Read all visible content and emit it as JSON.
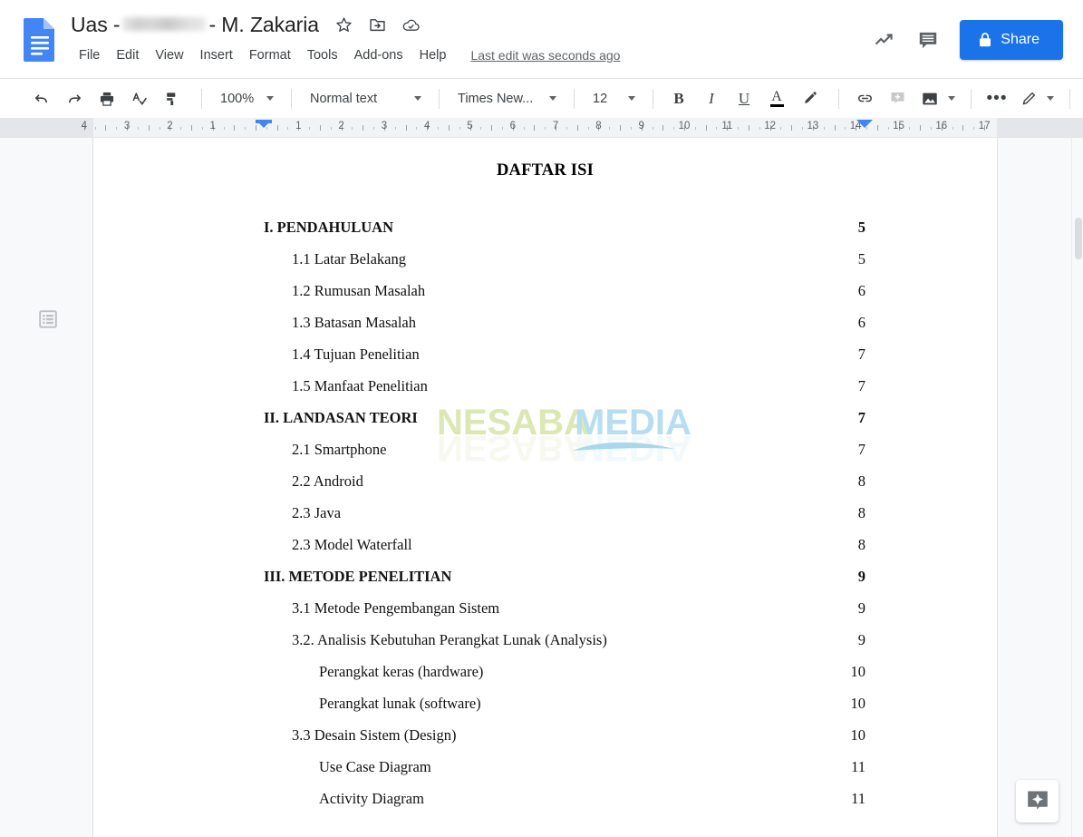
{
  "app": {
    "logo_icon": "google-docs-logo",
    "title_prefix": "Uas -",
    "title_suffix": "- M. Zakaria",
    "title_full": "Uas - [redacted] - M. Zakaria"
  },
  "title_icons": [
    {
      "name": "star-icon",
      "label": "Star"
    },
    {
      "name": "move-to-folder-icon",
      "label": "Move to folder"
    },
    {
      "name": "cloud-saved-icon",
      "label": "See document status"
    }
  ],
  "menu": {
    "items": [
      "File",
      "Edit",
      "View",
      "Insert",
      "Format",
      "Tools",
      "Add-ons",
      "Help"
    ],
    "last_edit": "Last edit was seconds ago"
  },
  "header_right": {
    "activity_icon": "trending-up-icon",
    "comment_icon": "comment-icon",
    "share_label": "Share",
    "share_lock_icon": "lock-icon",
    "share_color": "#1a73e8"
  },
  "toolbar": {
    "undo_icon": "undo-icon",
    "redo_icon": "redo-icon",
    "print_icon": "print-icon",
    "spelling_icon": "spellcheck-icon",
    "paint_format_icon": "paint-format-icon",
    "zoom": "100%",
    "paragraph_style": "Normal text",
    "font": "Times New...",
    "font_size": "12",
    "bold_label": "B",
    "italic_label": "I",
    "underline_label": "U",
    "text_color_label": "A",
    "highlight_icon": "highlight-pen-icon",
    "link_icon": "link-icon",
    "comment_icon": "add-comment-icon",
    "image_icon": "insert-image-icon",
    "more_label": "•••",
    "editing_mode_icon": "edit-pencil-icon",
    "collapse_icon": "chevron-up-icon"
  },
  "ruler": {
    "left_numbers": [
      "4",
      "3",
      "2",
      "1"
    ],
    "right_numbers": [
      "1",
      "2",
      "3",
      "4",
      "5",
      "6",
      "7",
      "8",
      "9",
      "10",
      "11",
      "12",
      "13",
      "14",
      "15",
      "16",
      "17"
    ],
    "left_indent_marker": "left-indent-marker",
    "right_indent_marker": "right-indent-marker"
  },
  "sidebar": {
    "outline_icon": "document-outline-icon"
  },
  "document": {
    "heading": "DAFTAR ISI",
    "toc": [
      {
        "level": 1,
        "text": "I. PENDAHULUAN",
        "page": "5"
      },
      {
        "level": 2,
        "text": "1.1 Latar Belakang",
        "page": "5"
      },
      {
        "level": 2,
        "text": "1.2 Rumusan Masalah",
        "page": "6"
      },
      {
        "level": 2,
        "text": "1.3 Batasan Masalah",
        "page": "6"
      },
      {
        "level": 2,
        "text": "1.4 Tujuan Penelitian",
        "page": "7"
      },
      {
        "level": 2,
        "text": "1.5 Manfaat Penelitian",
        "page": "7"
      },
      {
        "level": 1,
        "text": "II. LANDASAN TEORI",
        "page": "7"
      },
      {
        "level": 2,
        "text": "2.1 Smartphone",
        "page": "7"
      },
      {
        "level": 2,
        "text": "2.2 Android",
        "page": "8"
      },
      {
        "level": 2,
        "text": "2.3 Java",
        "page": "8"
      },
      {
        "level": 2,
        "text": "2.3 Model Waterfall",
        "page": "8"
      },
      {
        "level": 1,
        "text": "III. METODE PENELITIAN",
        "page": "9"
      },
      {
        "level": 2,
        "text": "3.1 Metode Pengembangan Sistem",
        "page": "9"
      },
      {
        "level": 2,
        "text": "3.2. Analisis Kebutuhan Perangkat Lunak (Analysis)",
        "page": "9"
      },
      {
        "level": 3,
        "text": "Perangkat keras (hardware)",
        "page": "10"
      },
      {
        "level": 3,
        "text": "Perangkat lunak (software)",
        "page": "10"
      },
      {
        "level": 2,
        "text": "3.3 Desain Sistem (Design)",
        "page": "10"
      },
      {
        "level": 3,
        "text": "Use Case Diagram",
        "page": "11"
      },
      {
        "level": 3,
        "text": "Activity Diagram",
        "page": "11"
      }
    ]
  },
  "watermark": {
    "part1": "NESABA",
    "part2": "MEDIA",
    "color1": "#dce8b4",
    "color2": "#b6def0"
  },
  "explore": {
    "icon": "explore-sparkle-icon",
    "label": "Explore"
  }
}
